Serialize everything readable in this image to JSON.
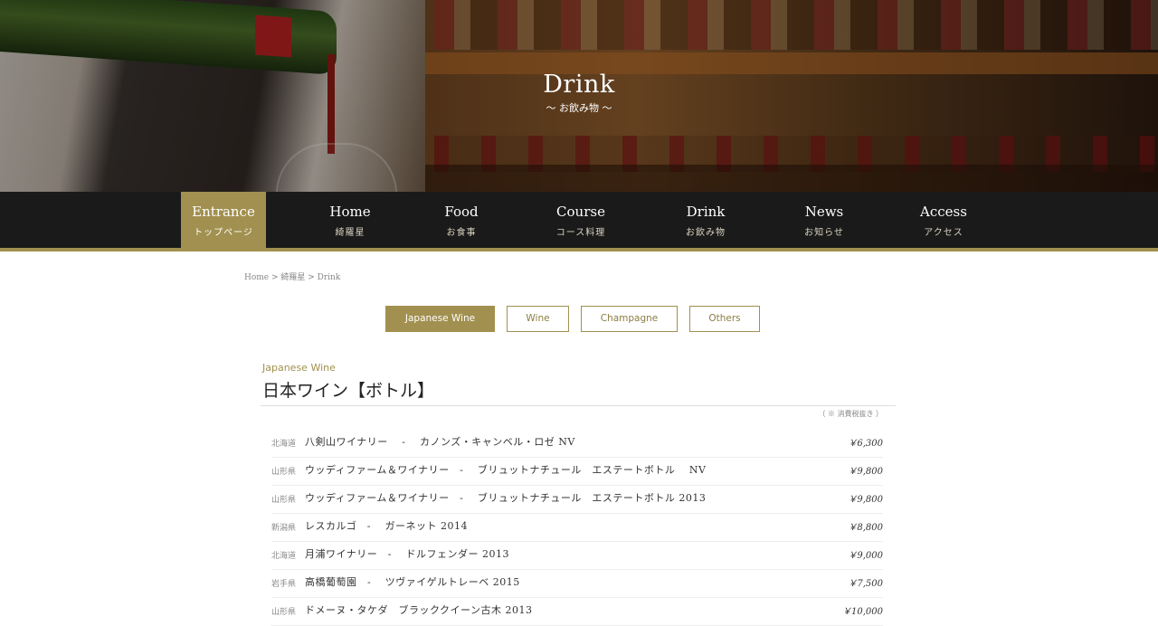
{
  "hero": {
    "title": "Drink",
    "subtitle": "〜 お飲み物 〜"
  },
  "nav": {
    "items": [
      {
        "en": "Entrance",
        "jp": "トップページ",
        "active": true
      },
      {
        "en": "Home",
        "jp": "綺羅星",
        "active": false
      },
      {
        "en": "Food",
        "jp": "お食事",
        "active": false
      },
      {
        "en": "Course",
        "jp": "コース料理",
        "active": false
      },
      {
        "en": "Drink",
        "jp": "お飲み物",
        "active": false
      },
      {
        "en": "News",
        "jp": "お知らせ",
        "active": false
      },
      {
        "en": "Access",
        "jp": "アクセス",
        "active": false
      }
    ]
  },
  "breadcrumb": "Home > 綺羅星 > Drink",
  "tabs": [
    {
      "label": "Japanese Wine",
      "active": true
    },
    {
      "label": "Wine",
      "active": false
    },
    {
      "label": "Champagne",
      "active": false
    },
    {
      "label": "Others",
      "active": false
    }
  ],
  "section": {
    "en": "Japanese Wine",
    "jp": "日本ワイン【ボトル】",
    "tax_note": "（ ※ 消費税抜き ）"
  },
  "wines": [
    {
      "pref": "北海道",
      "name": "八剣山ワイナリー　 -　 カノンズ・キャンベル・ロゼ NV",
      "price": "￥6,300"
    },
    {
      "pref": "山形県",
      "name": "ウッディファーム＆ワイナリー　-　 ブリュットナチュール　エステートボトル　 NV",
      "price": "￥9,800"
    },
    {
      "pref": "山形県",
      "name": "ウッディファーム＆ワイナリー　-　 ブリュットナチュール　エステートボトル 2013",
      "price": "￥9,800"
    },
    {
      "pref": "新潟県",
      "name": "レスカルゴ　-　 ガーネット 2014",
      "price": "￥8,800"
    },
    {
      "pref": "北海道",
      "name": "月浦ワイナリー　-　 ドルフェンダー 2013",
      "price": "￥9,000"
    },
    {
      "pref": "岩手県",
      "name": "高橋葡萄園　-　 ツヴァイゲルトレーベ 2015",
      "price": "￥7,500"
    },
    {
      "pref": "山形県",
      "name": "ドメーヌ・タケダ　ブラッククイーン古木 2013",
      "price": "￥10,000"
    }
  ],
  "colors": {
    "accent": "#a1904f",
    "nav_bg": "#1a1a1a"
  }
}
